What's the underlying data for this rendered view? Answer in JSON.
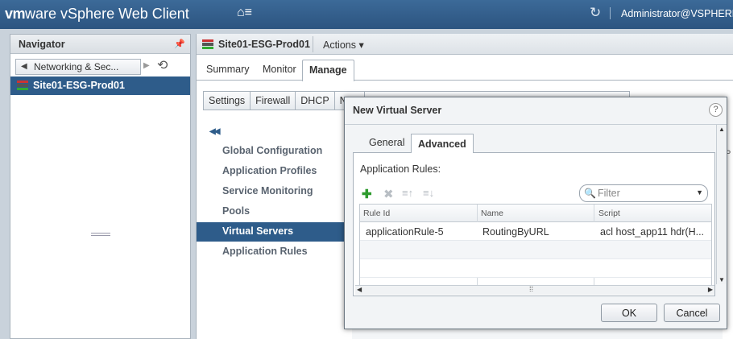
{
  "header": {
    "brand_vm": "vm",
    "brand_ware": "ware",
    "brand_product": " vSphere Web Client",
    "user": "Administrator@VSPHERE"
  },
  "navigator": {
    "title": "Navigator",
    "breadcrumb": "Networking & Sec...",
    "selected_item": "Site01-ESG-Prod01"
  },
  "object": {
    "title": "Site01-ESG-Prod01",
    "actions_label": "Actions ▾",
    "tabs": [
      "Summary",
      "Monitor",
      "Manage"
    ],
    "subtabs": [
      "Settings",
      "Firewall",
      "DHCP",
      "NAT"
    ],
    "lb_menu": [
      "Global Configuration",
      "Application Profiles",
      "Service Monitoring",
      "Pools",
      "Virtual Servers",
      "Application Rules"
    ]
  },
  "dialog": {
    "title": "New Virtual Server",
    "help": "?",
    "tabs": [
      "General",
      "Advanced"
    ],
    "section_label": "Application Rules:",
    "filter_placeholder": "Filter",
    "columns": [
      "Rule Id",
      "Name",
      "Script"
    ],
    "rows": [
      {
        "rule_id": "applicationRule-5",
        "name": "RoutingByURL",
        "script": "acl host_app11 hdr(H..."
      }
    ],
    "ok_label": "OK",
    "cancel_label": "Cancel"
  },
  "colors": {
    "accent": "#2e5c8a",
    "header": "#2c5480",
    "add": "#2e9b2e"
  }
}
